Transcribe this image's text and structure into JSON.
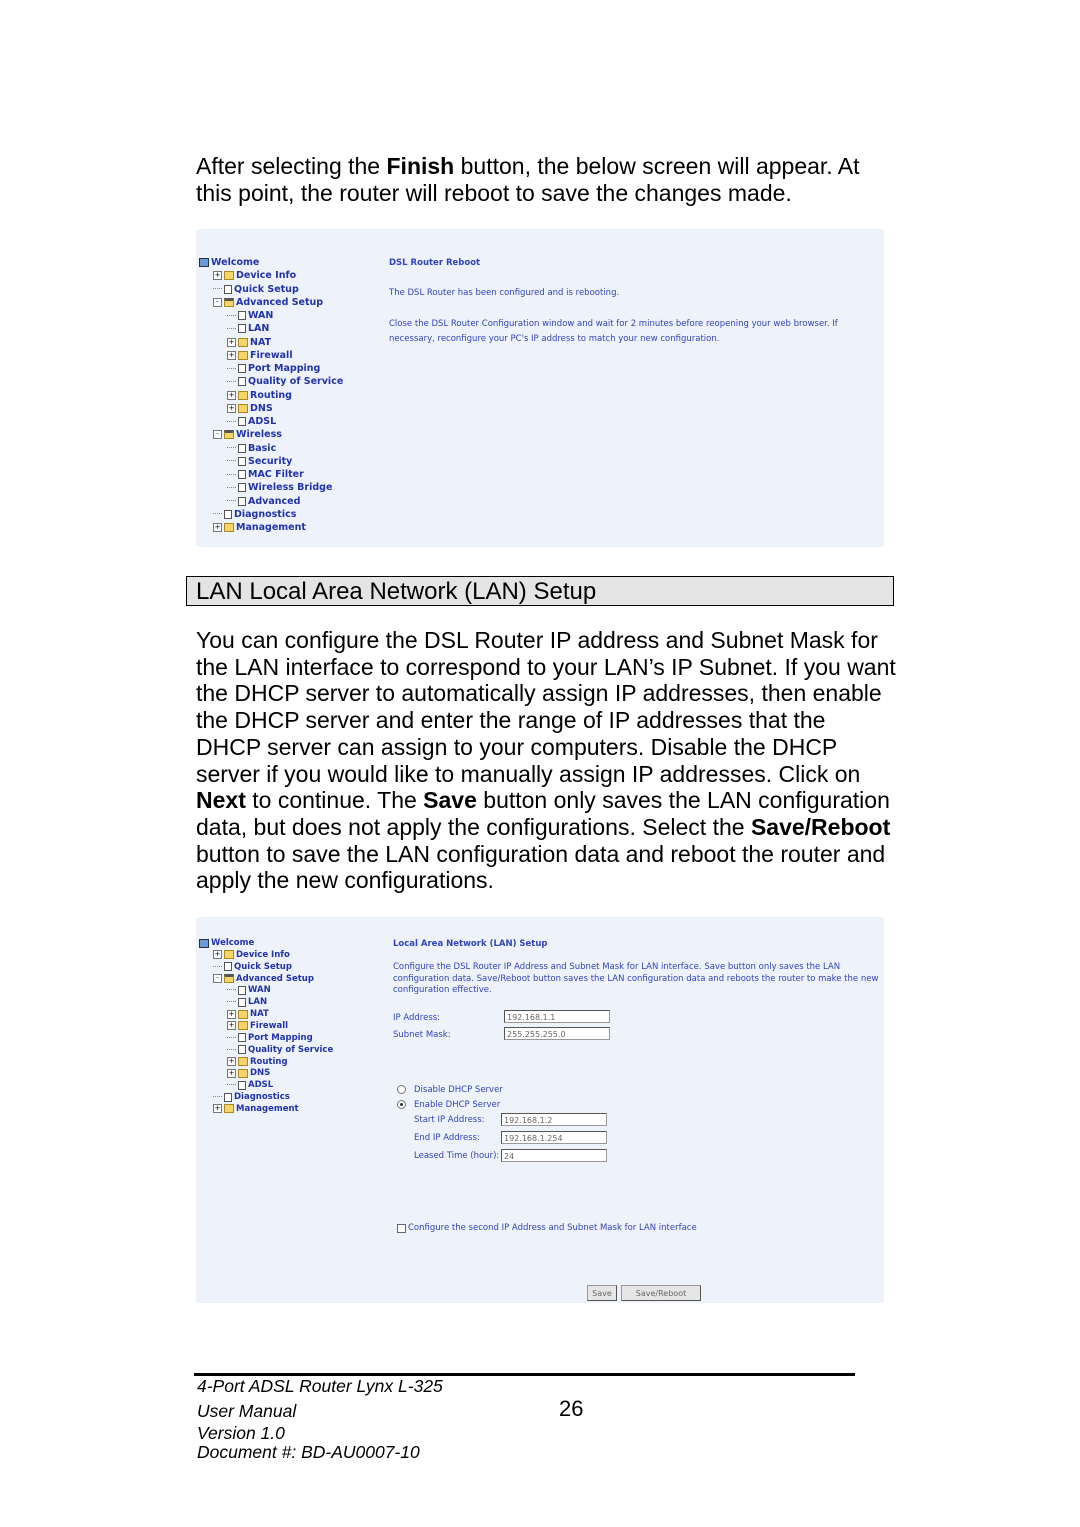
{
  "intro": {
    "pre": "After selecting the ",
    "bold": "Finish",
    "post": " button, the below screen will appear.  At this point, the router will reboot to save the changes made."
  },
  "shot1": {
    "tree": [
      {
        "label": "Welcome",
        "level": 0,
        "icon": "pc",
        "exp": ""
      },
      {
        "label": "Device Info",
        "level": 1,
        "icon": "folder",
        "exp": "+"
      },
      {
        "label": "Quick Setup",
        "level": 1,
        "icon": "doc",
        "exp": ""
      },
      {
        "label": "Advanced Setup",
        "level": 1,
        "icon": "open",
        "exp": "-"
      },
      {
        "label": "WAN",
        "level": 2,
        "icon": "doc",
        "exp": ""
      },
      {
        "label": "LAN",
        "level": 2,
        "icon": "doc",
        "exp": ""
      },
      {
        "label": "NAT",
        "level": 2,
        "icon": "folder",
        "exp": "+"
      },
      {
        "label": "Firewall",
        "level": 2,
        "icon": "folder",
        "exp": "+"
      },
      {
        "label": "Port Mapping",
        "level": 2,
        "icon": "doc",
        "exp": ""
      },
      {
        "label": "Quality of Service",
        "level": 2,
        "icon": "doc",
        "exp": ""
      },
      {
        "label": "Routing",
        "level": 2,
        "icon": "folder",
        "exp": "+"
      },
      {
        "label": "DNS",
        "level": 2,
        "icon": "folder",
        "exp": "+"
      },
      {
        "label": "ADSL",
        "level": 2,
        "icon": "doc",
        "exp": ""
      },
      {
        "label": "Wireless",
        "level": 1,
        "icon": "open",
        "exp": "-"
      },
      {
        "label": "Basic",
        "level": 2,
        "icon": "doc",
        "exp": ""
      },
      {
        "label": "Security",
        "level": 2,
        "icon": "doc",
        "exp": ""
      },
      {
        "label": "MAC Filter",
        "level": 2,
        "icon": "doc",
        "exp": ""
      },
      {
        "label": "Wireless Bridge",
        "level": 2,
        "icon": "doc",
        "exp": ""
      },
      {
        "label": "Advanced",
        "level": 2,
        "icon": "doc",
        "exp": ""
      },
      {
        "label": "Diagnostics",
        "level": 1,
        "icon": "doc",
        "exp": ""
      },
      {
        "label": "Management",
        "level": 1,
        "icon": "folder",
        "exp": "+"
      }
    ],
    "title": "DSL Router Reboot",
    "msg1": "The DSL Router has been configured and is rebooting.",
    "msg2": "Close the DSL Router Configuration window and wait for 2 minutes before reopening your web browser. If necessary, reconfigure your PC's IP address to match your new configuration."
  },
  "heading": "LAN Local Area Network (LAN) Setup",
  "body": {
    "t1": "You can configure the DSL Router IP address and Subnet Mask for the LAN interface to correspond to your LAN’s IP Subnet. If you want the DHCP server to automatically assign IP addresses, then enable the DHCP server and enter the range of IP addresses that the DHCP server can assign to your computers.  Disable the DHCP server if you would like to manually assign IP addresses. Click on ",
    "b1": "Next",
    "t2": " to continue.  The ",
    "b2": "Save",
    "t3": " button only saves the LAN configuration data, but does not apply the configurations.  Select the ",
    "b3": "Save/Reboot",
    "t4": " button to save the LAN configuration data and reboot the router and apply the new configurations."
  },
  "shot2": {
    "tree": [
      {
        "label": "Welcome",
        "level": 0,
        "icon": "pc",
        "exp": ""
      },
      {
        "label": "Device Info",
        "level": 1,
        "icon": "folder",
        "exp": "+"
      },
      {
        "label": "Quick Setup",
        "level": 1,
        "icon": "doc",
        "exp": ""
      },
      {
        "label": "Advanced Setup",
        "level": 1,
        "icon": "open",
        "exp": "-"
      },
      {
        "label": "WAN",
        "level": 2,
        "icon": "doc",
        "exp": ""
      },
      {
        "label": "LAN",
        "level": 2,
        "icon": "doc",
        "exp": ""
      },
      {
        "label": "NAT",
        "level": 2,
        "icon": "folder",
        "exp": "+"
      },
      {
        "label": "Firewall",
        "level": 2,
        "icon": "folder",
        "exp": "+"
      },
      {
        "label": "Port Mapping",
        "level": 2,
        "icon": "doc",
        "exp": ""
      },
      {
        "label": "Quality of Service",
        "level": 2,
        "icon": "doc",
        "exp": ""
      },
      {
        "label": "Routing",
        "level": 2,
        "icon": "folder",
        "exp": "+"
      },
      {
        "label": "DNS",
        "level": 2,
        "icon": "folder",
        "exp": "+"
      },
      {
        "label": "ADSL",
        "level": 2,
        "icon": "doc",
        "exp": ""
      },
      {
        "label": "Diagnostics",
        "level": 1,
        "icon": "doc",
        "exp": ""
      },
      {
        "label": "Management",
        "level": 1,
        "icon": "folder",
        "exp": "+"
      }
    ],
    "title": "Local Area Network (LAN) Setup",
    "desc": "Configure the DSL Router IP Address and Subnet Mask for LAN interface.  Save button only saves the LAN configuration data.  Save/Reboot button saves the LAN configuration data and reboots the router to make the new configuration effective.",
    "ip_label": "IP Address:",
    "ip_value": "192.168.1.1",
    "mask_label": "Subnet Mask:",
    "mask_value": "255.255.255.0",
    "dhcp_disable": "Disable DHCP Server",
    "dhcp_enable": "Enable DHCP Server",
    "dhcp_selected": "enable",
    "start_label": "Start IP Address:",
    "start_value": "192.168.1.2",
    "end_label": "End IP Address:",
    "end_value": "192.168.1.254",
    "lease_label": "Leased Time (hour):",
    "lease_value": "24",
    "second_ip_label": "Configure the second IP Address and Subnet Mask for LAN interface",
    "second_ip_checked": false,
    "save": "Save",
    "save_reboot": "Save/Reboot"
  },
  "footer": {
    "l1": "4-Port ADSL Router Lynx L-325",
    "l2": "User Manual",
    "l3": "Version 1.0",
    "l4": "Document #:  BD-AU0007-10",
    "page": "26"
  }
}
